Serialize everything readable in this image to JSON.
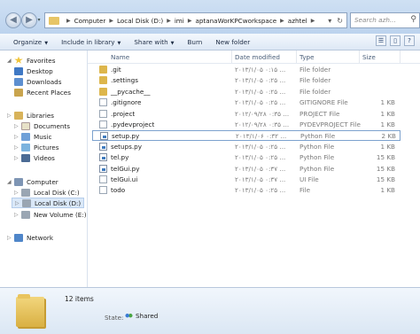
{
  "address": {
    "crumbs": [
      "Computer",
      "Local Disk (D:)",
      "imi",
      "aptanaWorKPCworkspace",
      "azhtel"
    ],
    "search_placeholder": "Search azh..."
  },
  "toolbar": {
    "organize": "Organize",
    "include": "Include in library",
    "share": "Share with",
    "burn": "Burn",
    "new_folder": "New folder"
  },
  "nav": {
    "favorites": "Favorites",
    "desktop": "Desktop",
    "downloads": "Downloads",
    "recent": "Recent Places",
    "libraries": "Libraries",
    "documents": "Documents",
    "music": "Music",
    "pictures": "Pictures",
    "videos": "Videos",
    "computer": "Computer",
    "disk_c": "Local Disk (C:)",
    "disk_d": "Local Disk (D:)",
    "volume_e": "New Volume (E:)",
    "network": "Network"
  },
  "columns": {
    "name": "Name",
    "date": "Date modified",
    "type": "Type",
    "size": "Size"
  },
  "files": [
    {
      "name": ".git",
      "date": "۲۰۱۳/۱/۰۵ ۰:۱۵ ...",
      "type": "File folder",
      "size": "",
      "kind": "folder"
    },
    {
      "name": ".settings",
      "date": "۲۰۱۳/۱/۰۵ ۰:۲۵ ...",
      "type": "File folder",
      "size": "",
      "kind": "folder"
    },
    {
      "name": "__pycache__",
      "date": "۲۰۱۳/۱/۰۵ ۰:۲۵ ...",
      "type": "File folder",
      "size": "",
      "kind": "folder"
    },
    {
      "name": ".gitignore",
      "date": "۲۰۱۳/۱/۰۵ ۰:۲۵ ...",
      "type": "GITIGNORE File",
      "size": "1 KB",
      "kind": "doc"
    },
    {
      "name": ".project",
      "date": "۲۰۱۲/۰۹/۲۸ ۰:۳۵ ...",
      "type": "PROJECT File",
      "size": "1 KB",
      "kind": "doc"
    },
    {
      "name": ".pydevproject",
      "date": "۲۰۱۲/۰۹/۲۸ ۰:۳۵ ...",
      "type": "PYDEVPROJECT File",
      "size": "1 KB",
      "kind": "doc"
    },
    {
      "name": "setup.py",
      "date": "۲۰۱۳/۱/۰۶ ۰:۳۲ ...",
      "type": "Python File",
      "size": "2 KB",
      "kind": "py",
      "selected": true
    },
    {
      "name": "setups.py",
      "date": "۲۰۱۳/۱/۰۵ ۰:۲۵ ...",
      "type": "Python File",
      "size": "1 KB",
      "kind": "py"
    },
    {
      "name": "tel.py",
      "date": "۲۰۱۳/۱/۰۵ ۰:۲۵ ...",
      "type": "Python File",
      "size": "15 KB",
      "kind": "py"
    },
    {
      "name": "telGui.py",
      "date": "۲۰۱۳/۱/۰۵ ۰:۳۷ ...",
      "type": "Python File",
      "size": "15 KB",
      "kind": "py"
    },
    {
      "name": "telGui.ui",
      "date": "۲۰۱۳/۱/۰۵ ۰:۳۷ ...",
      "type": "UI File",
      "size": "15 KB",
      "kind": "doc"
    },
    {
      "name": "todo",
      "date": "۲۰۱۳/۱/۰۵ ۰:۲۵ ...",
      "type": "File",
      "size": "1 KB",
      "kind": "doc"
    }
  ],
  "status": {
    "count": "12 items",
    "state_label": "State:",
    "state_value": "Shared"
  }
}
